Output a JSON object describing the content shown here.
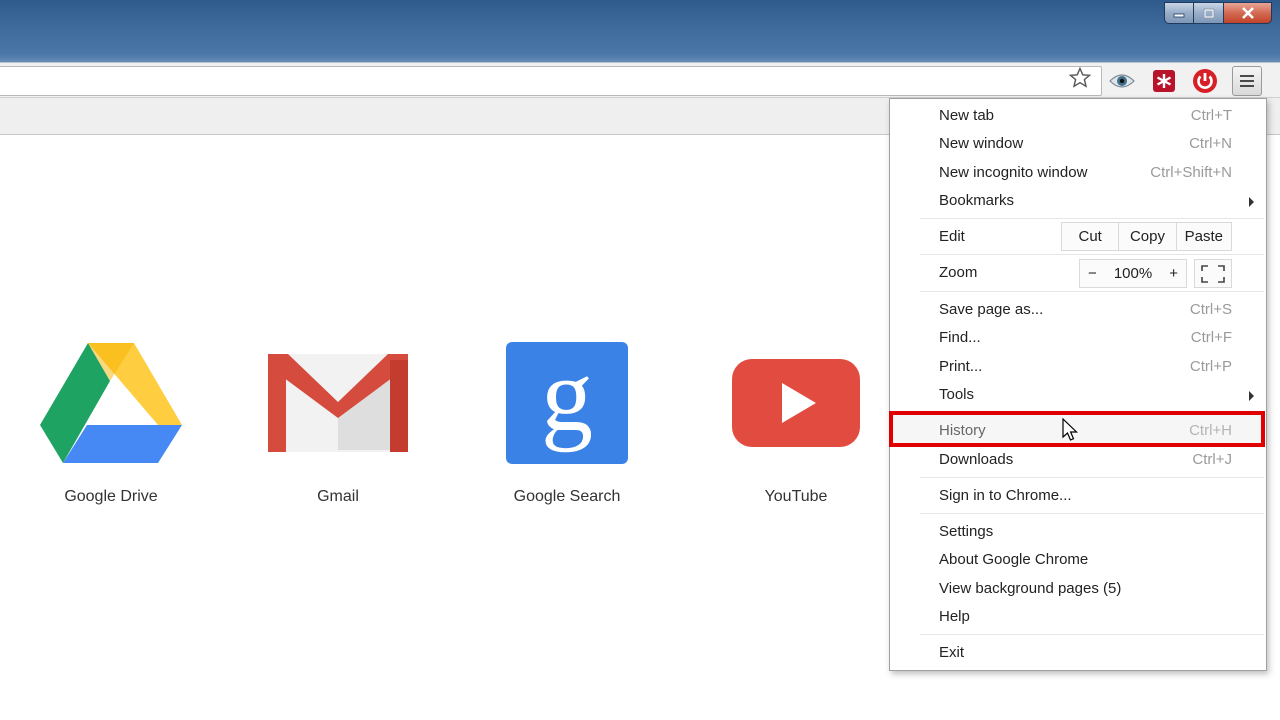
{
  "window": {
    "buttons": [
      {
        "name": "minimize",
        "icon": "minimize-icon"
      },
      {
        "name": "maximize",
        "icon": "maximize-icon"
      },
      {
        "name": "close",
        "icon": "close-icon"
      }
    ]
  },
  "toolbar": {
    "omnibox_value": "",
    "extensions": [
      "eye-icon",
      "asterisk-icon",
      "power-icon"
    ]
  },
  "apps": [
    {
      "label": "Google Drive",
      "icon": "google-drive-icon"
    },
    {
      "label": "Gmail",
      "icon": "gmail-icon"
    },
    {
      "label": "Google Search",
      "icon": "google-search-icon"
    },
    {
      "label": "YouTube",
      "icon": "youtube-icon"
    }
  ],
  "menu": {
    "new_tab": {
      "label": "New tab",
      "shortcut": "Ctrl+T"
    },
    "new_window": {
      "label": "New window",
      "shortcut": "Ctrl+N"
    },
    "new_incognito": {
      "label": "New incognito window",
      "shortcut": "Ctrl+Shift+N"
    },
    "bookmarks": {
      "label": "Bookmarks"
    },
    "edit": {
      "label": "Edit",
      "cut": "Cut",
      "copy": "Copy",
      "paste": "Paste"
    },
    "zoom": {
      "label": "Zoom",
      "minus": "−",
      "value": "100%",
      "plus": "+"
    },
    "save_page": {
      "label": "Save page as...",
      "shortcut": "Ctrl+S"
    },
    "find": {
      "label": "Find...",
      "shortcut": "Ctrl+F"
    },
    "print": {
      "label": "Print...",
      "shortcut": "Ctrl+P"
    },
    "tools": {
      "label": "Tools"
    },
    "history": {
      "label": "History",
      "shortcut": "Ctrl+H"
    },
    "downloads": {
      "label": "Downloads",
      "shortcut": "Ctrl+J"
    },
    "sign_in": {
      "label": "Sign in to Chrome..."
    },
    "settings": {
      "label": "Settings"
    },
    "about": {
      "label": "About Google Chrome"
    },
    "background_pages": {
      "label": "View background pages (5)"
    },
    "help": {
      "label": "Help"
    },
    "exit": {
      "label": "Exit"
    }
  },
  "colors": {
    "highlight": "#e00000",
    "drive_green": "#1ea362",
    "drive_yellow": "#ffcd40",
    "drive_blue": "#4688f4",
    "gmail_red": "#d54b3d",
    "search_blue": "#3b82e6",
    "youtube_red": "#e24b3f"
  }
}
